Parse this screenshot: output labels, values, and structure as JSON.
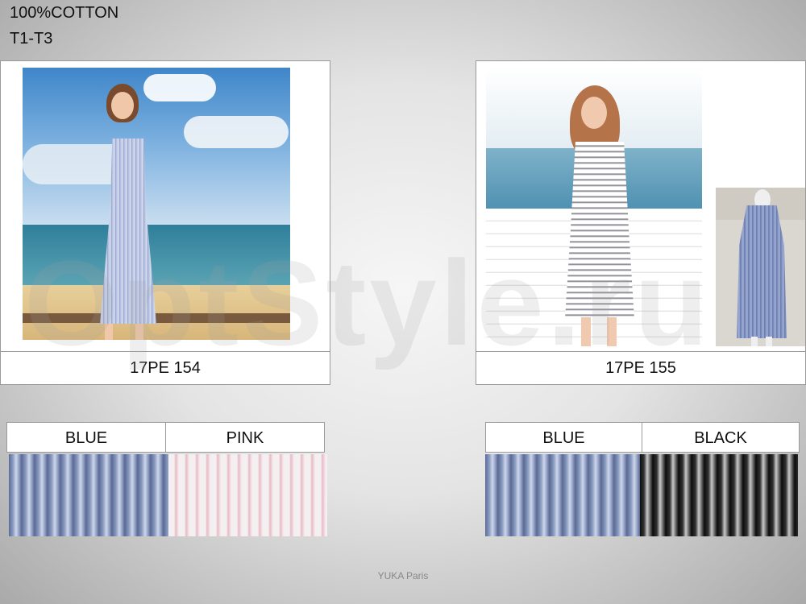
{
  "header": {
    "material": "100%COTTON",
    "sizes": "T1-T3"
  },
  "products": [
    {
      "code": "17PE 154",
      "colors": [
        {
          "name": "BLUE",
          "pattern": "stripe-blue",
          "hex": "#7b8cb5"
        },
        {
          "name": "PINK",
          "pattern": "stripe-pink",
          "hex": "#e8b9c4"
        }
      ]
    },
    {
      "code": "17PE 155",
      "colors": [
        {
          "name": "BLUE",
          "pattern": "stripe-blue",
          "hex": "#7b8cb5"
        },
        {
          "name": "BLACK",
          "pattern": "stripe-black",
          "hex": "#1a1a1a"
        }
      ]
    }
  ],
  "watermark": "OptStyle.ru",
  "footer": {
    "brand": "YUKA Paris"
  }
}
